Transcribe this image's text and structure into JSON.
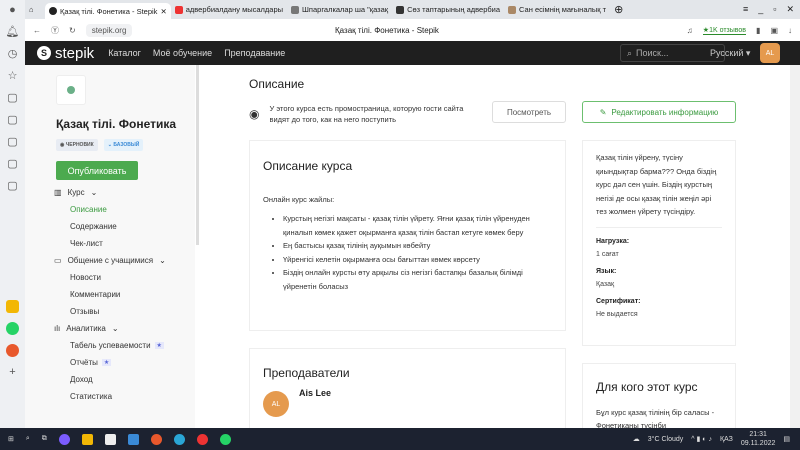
{
  "browser": {
    "tabs": [
      {
        "label": "Қазақ тілі. Фонетика - Stepik",
        "active": true
      },
      {
        "label": "адвербиалдану мысалдары"
      },
      {
        "label": "Шпаргалкалар ша \"қазақ"
      },
      {
        "label": "Сөз таптарының адвербиа"
      },
      {
        "label": "Сан есімнің мағыналық т"
      }
    ],
    "url": "stepik.org",
    "page_title": "Қазақ тілі. Фонетика - Stepik",
    "reviews": "★1K отзывов"
  },
  "nav": {
    "brand": "stepik",
    "links": [
      "Каталог",
      "Моё обучение",
      "Преподавание"
    ],
    "search_placeholder": "Поиск...",
    "language": "Русский",
    "avatar": "AL"
  },
  "sidebar": {
    "course_title": "Қазақ тілі. Фонетика",
    "badges": [
      "ЧЕРНОВИК",
      "БАЗОВЫЙ"
    ],
    "publish": "Опубликовать",
    "groups": [
      {
        "label": "Курс",
        "items": [
          "Описание",
          "Содержание",
          "Чек-лист"
        ]
      },
      {
        "label": "Общение с учащимися",
        "items": [
          "Новости",
          "Комментарии",
          "Отзывы"
        ]
      },
      {
        "label": "Аналитика",
        "items": [
          "Табель успеваемости",
          "Отчёты",
          "Доход",
          "Статистика"
        ]
      }
    ]
  },
  "main": {
    "heading": "Описание",
    "promo_text": "У этого курса есть промостраница, которую гости сайта видят до того, как на него поступить",
    "view_button": "Посмотреть",
    "edit_button": "Редактировать информацию",
    "description": {
      "title": "Описание курса",
      "intro": "Онлайн курс жайлы:",
      "bullets": [
        "Курстың негізгі мақсаты - қазақ тілін үйрету. Яғни қазақ тілін үйренуден қиналып көмек қажет оқырманға қазақ тілін бастап кетуге көмек беру",
        "Ең бастысы қазақ тілінің ауқымын көбейту",
        "Үйренгісі келетін оқырманға осы бағыттан көмек көрсету",
        "Біздің онлайн курсты өту арқылы сіз негізгі бастапқы базалық білімді үйренетін боласыз"
      ]
    },
    "summary": "Қазақ тілін үйрену, түсіну қиындықтар барма??? Онда біздің курс дәл сен үшін. Біздің курстың негізі де осы қазақ тілін жеңіл әрі тез жолмен үйрету түсіндіру.",
    "meta": [
      {
        "label": "Нагрузка:",
        "value": "1 сағат"
      },
      {
        "label": "Язык:",
        "value": "Қазақ"
      },
      {
        "label": "Сертификат:",
        "value": "Не выдается"
      }
    ],
    "teachers": {
      "title": "Преподаватели",
      "name": "Ais Lee",
      "initials": "AL"
    },
    "audience": {
      "title": "Для кого этот курс",
      "text": "Бұл курс қазақ тілінің бір саласы - Фонетиканы түсінби"
    }
  },
  "taskbar": {
    "weather": "3°C Cloudy",
    "lang": "ҚАЗ",
    "time": "21:31",
    "date": "09.11.2022"
  }
}
